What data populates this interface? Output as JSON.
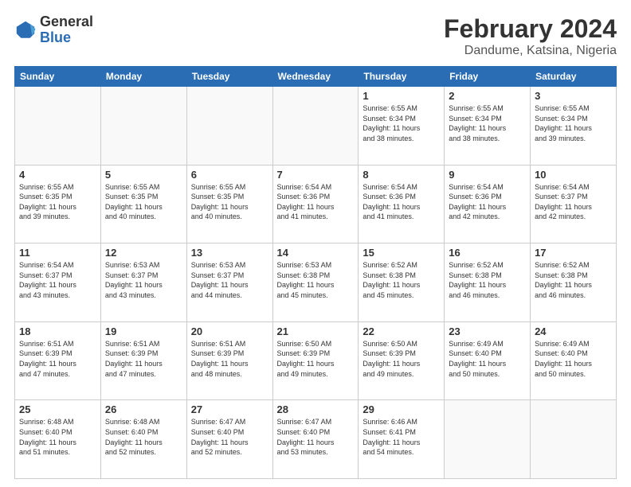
{
  "logo": {
    "general": "General",
    "blue": "Blue"
  },
  "title": {
    "month_year": "February 2024",
    "location": "Dandume, Katsina, Nigeria"
  },
  "headers": [
    "Sunday",
    "Monday",
    "Tuesday",
    "Wednesday",
    "Thursday",
    "Friday",
    "Saturday"
  ],
  "weeks": [
    [
      {
        "day": "",
        "info": ""
      },
      {
        "day": "",
        "info": ""
      },
      {
        "day": "",
        "info": ""
      },
      {
        "day": "",
        "info": ""
      },
      {
        "day": "1",
        "info": "Sunrise: 6:55 AM\nSunset: 6:34 PM\nDaylight: 11 hours\nand 38 minutes."
      },
      {
        "day": "2",
        "info": "Sunrise: 6:55 AM\nSunset: 6:34 PM\nDaylight: 11 hours\nand 38 minutes."
      },
      {
        "day": "3",
        "info": "Sunrise: 6:55 AM\nSunset: 6:34 PM\nDaylight: 11 hours\nand 39 minutes."
      }
    ],
    [
      {
        "day": "4",
        "info": "Sunrise: 6:55 AM\nSunset: 6:35 PM\nDaylight: 11 hours\nand 39 minutes."
      },
      {
        "day": "5",
        "info": "Sunrise: 6:55 AM\nSunset: 6:35 PM\nDaylight: 11 hours\nand 40 minutes."
      },
      {
        "day": "6",
        "info": "Sunrise: 6:55 AM\nSunset: 6:35 PM\nDaylight: 11 hours\nand 40 minutes."
      },
      {
        "day": "7",
        "info": "Sunrise: 6:54 AM\nSunset: 6:36 PM\nDaylight: 11 hours\nand 41 minutes."
      },
      {
        "day": "8",
        "info": "Sunrise: 6:54 AM\nSunset: 6:36 PM\nDaylight: 11 hours\nand 41 minutes."
      },
      {
        "day": "9",
        "info": "Sunrise: 6:54 AM\nSunset: 6:36 PM\nDaylight: 11 hours\nand 42 minutes."
      },
      {
        "day": "10",
        "info": "Sunrise: 6:54 AM\nSunset: 6:37 PM\nDaylight: 11 hours\nand 42 minutes."
      }
    ],
    [
      {
        "day": "11",
        "info": "Sunrise: 6:54 AM\nSunset: 6:37 PM\nDaylight: 11 hours\nand 43 minutes."
      },
      {
        "day": "12",
        "info": "Sunrise: 6:53 AM\nSunset: 6:37 PM\nDaylight: 11 hours\nand 43 minutes."
      },
      {
        "day": "13",
        "info": "Sunrise: 6:53 AM\nSunset: 6:37 PM\nDaylight: 11 hours\nand 44 minutes."
      },
      {
        "day": "14",
        "info": "Sunrise: 6:53 AM\nSunset: 6:38 PM\nDaylight: 11 hours\nand 45 minutes."
      },
      {
        "day": "15",
        "info": "Sunrise: 6:52 AM\nSunset: 6:38 PM\nDaylight: 11 hours\nand 45 minutes."
      },
      {
        "day": "16",
        "info": "Sunrise: 6:52 AM\nSunset: 6:38 PM\nDaylight: 11 hours\nand 46 minutes."
      },
      {
        "day": "17",
        "info": "Sunrise: 6:52 AM\nSunset: 6:38 PM\nDaylight: 11 hours\nand 46 minutes."
      }
    ],
    [
      {
        "day": "18",
        "info": "Sunrise: 6:51 AM\nSunset: 6:39 PM\nDaylight: 11 hours\nand 47 minutes."
      },
      {
        "day": "19",
        "info": "Sunrise: 6:51 AM\nSunset: 6:39 PM\nDaylight: 11 hours\nand 47 minutes."
      },
      {
        "day": "20",
        "info": "Sunrise: 6:51 AM\nSunset: 6:39 PM\nDaylight: 11 hours\nand 48 minutes."
      },
      {
        "day": "21",
        "info": "Sunrise: 6:50 AM\nSunset: 6:39 PM\nDaylight: 11 hours\nand 49 minutes."
      },
      {
        "day": "22",
        "info": "Sunrise: 6:50 AM\nSunset: 6:39 PM\nDaylight: 11 hours\nand 49 minutes."
      },
      {
        "day": "23",
        "info": "Sunrise: 6:49 AM\nSunset: 6:40 PM\nDaylight: 11 hours\nand 50 minutes."
      },
      {
        "day": "24",
        "info": "Sunrise: 6:49 AM\nSunset: 6:40 PM\nDaylight: 11 hours\nand 50 minutes."
      }
    ],
    [
      {
        "day": "25",
        "info": "Sunrise: 6:48 AM\nSunset: 6:40 PM\nDaylight: 11 hours\nand 51 minutes."
      },
      {
        "day": "26",
        "info": "Sunrise: 6:48 AM\nSunset: 6:40 PM\nDaylight: 11 hours\nand 52 minutes."
      },
      {
        "day": "27",
        "info": "Sunrise: 6:47 AM\nSunset: 6:40 PM\nDaylight: 11 hours\nand 52 minutes."
      },
      {
        "day": "28",
        "info": "Sunrise: 6:47 AM\nSunset: 6:40 PM\nDaylight: 11 hours\nand 53 minutes."
      },
      {
        "day": "29",
        "info": "Sunrise: 6:46 AM\nSunset: 6:41 PM\nDaylight: 11 hours\nand 54 minutes."
      },
      {
        "day": "",
        "info": ""
      },
      {
        "day": "",
        "info": ""
      }
    ]
  ]
}
